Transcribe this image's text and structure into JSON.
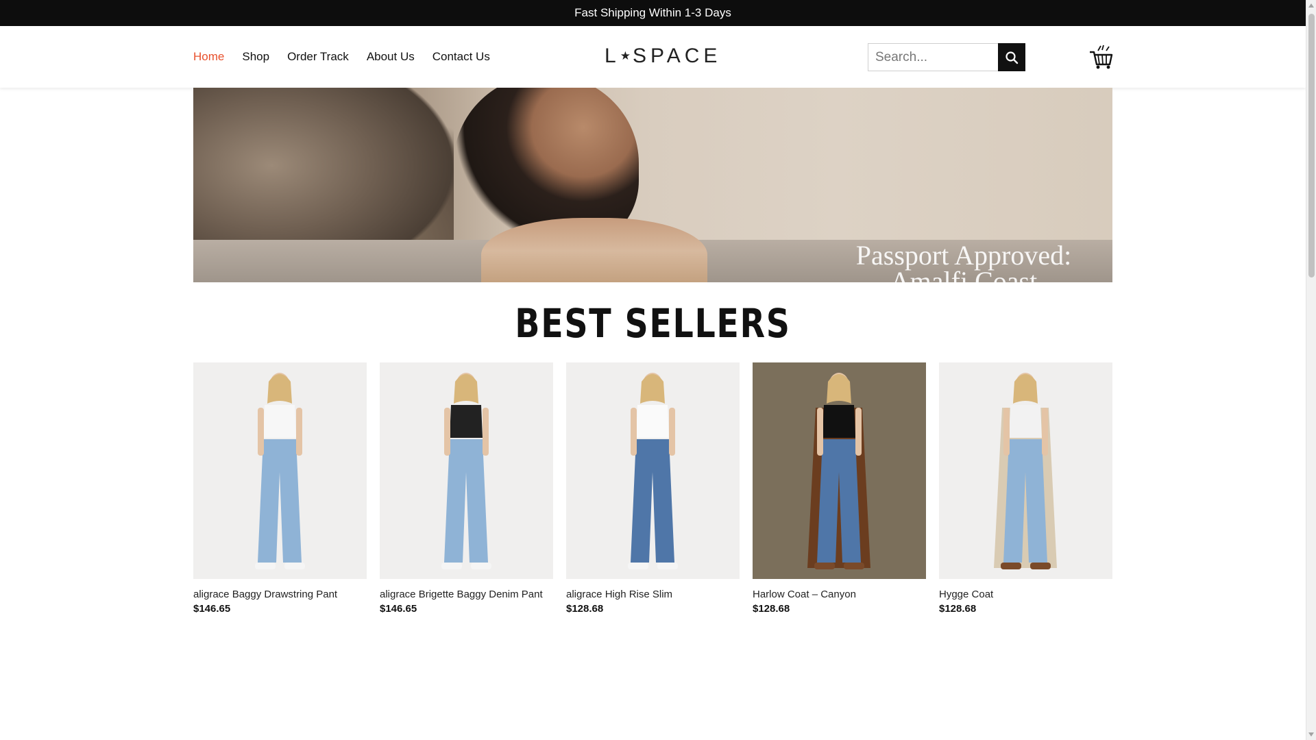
{
  "announcement": "Fast Shipping Within 1-3 Days",
  "nav": {
    "items": [
      {
        "label": "Home",
        "active": true
      },
      {
        "label": "Shop",
        "active": false
      },
      {
        "label": "Order Track",
        "active": false
      },
      {
        "label": "About Us",
        "active": false
      },
      {
        "label": "Contact Us",
        "active": false
      }
    ],
    "active_color": "#e8502c"
  },
  "logo": {
    "left": "L",
    "star": "★",
    "right": "SPACE"
  },
  "search": {
    "placeholder": "Search...",
    "value": "",
    "button_icon": "search-icon"
  },
  "cart": {
    "icon": "cart-icon"
  },
  "hero": {
    "caption_line1": "Passport Approved:",
    "caption_line2": "Amalfi Coast"
  },
  "section_title": "BEST SELLERS",
  "products": [
    {
      "name": "aligrace Baggy Drawstring Pant",
      "price": "$146.65",
      "top": "white-tee",
      "jeans": "light"
    },
    {
      "name": "aligrace Brigette Baggy Denim Pant",
      "price": "$146.65",
      "top": "black-tank",
      "jeans": "light"
    },
    {
      "name": "aligrace High Rise Slim",
      "price": "$128.68",
      "top": "white-tank",
      "jeans": "mid"
    },
    {
      "name": "Harlow Coat – Canyon",
      "price": "$128.68",
      "top": "plaid-coat",
      "jeans": "mid"
    },
    {
      "name": "Hygge Coat",
      "price": "$128.68",
      "top": "cream-coat",
      "jeans": "light"
    }
  ]
}
